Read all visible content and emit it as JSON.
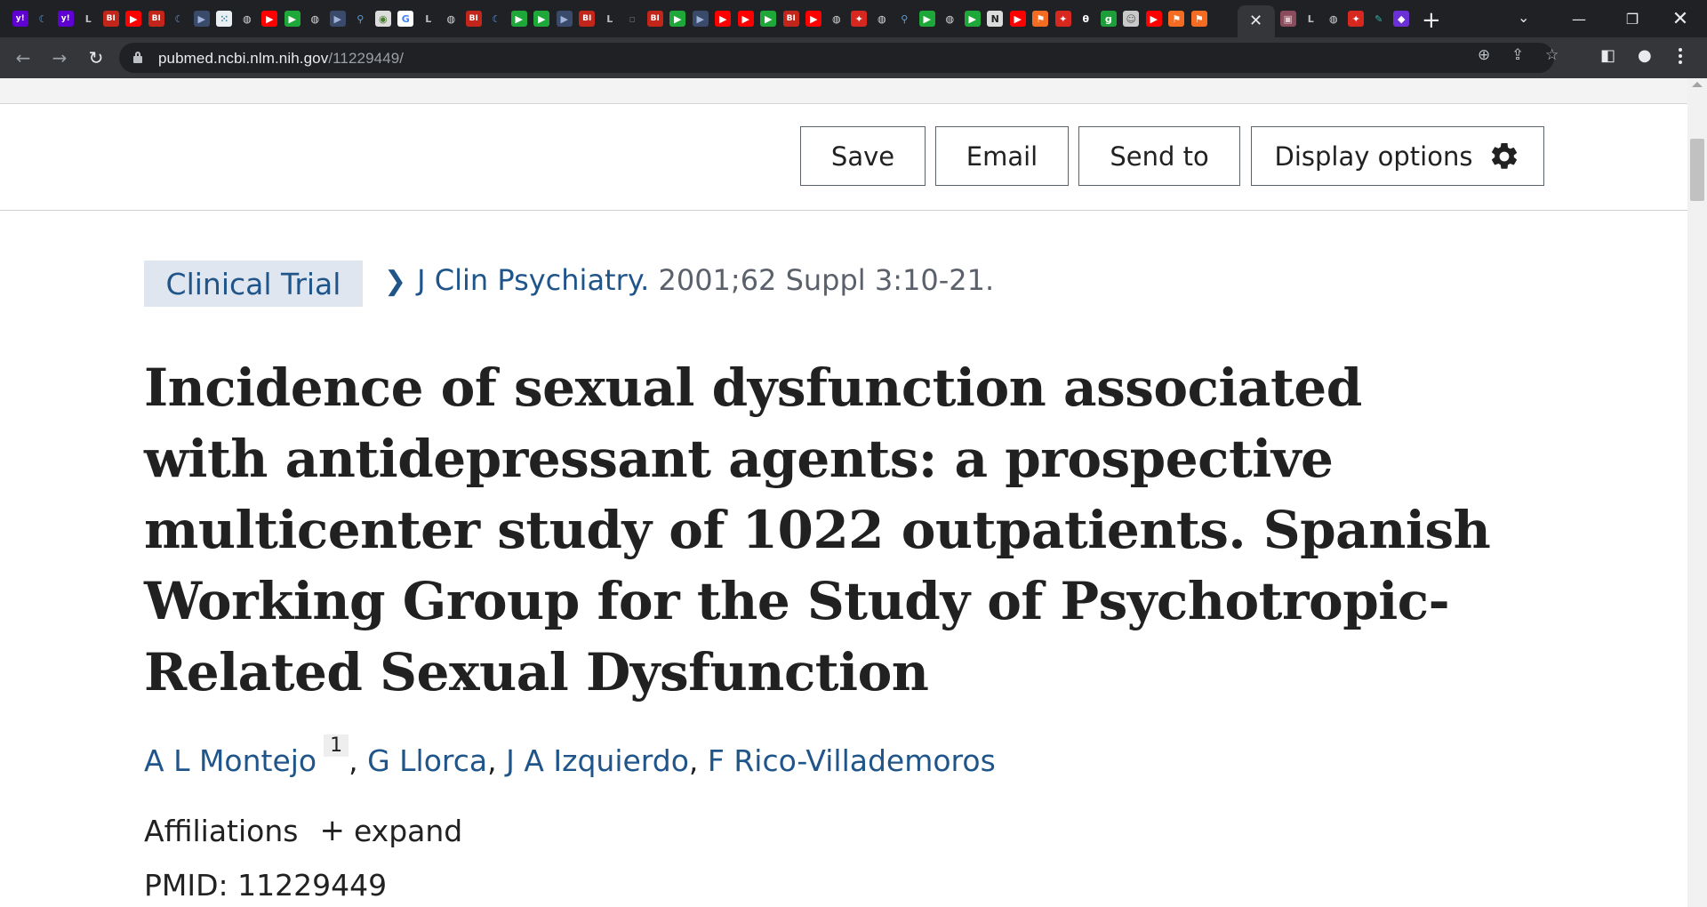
{
  "browser": {
    "url_host": "pubmed.ncbi.nlm.nih.gov",
    "url_path": "/11229449/",
    "tab_favicons": [
      {
        "icon": "yahoo-icon",
        "glyph": "y!",
        "bg": "#5f01d1",
        "fg": "#ffffff"
      },
      {
        "icon": "crescent-icon",
        "glyph": "☾",
        "bg": "#202124",
        "fg": "#5f9ee0"
      },
      {
        "icon": "yahoo-icon",
        "glyph": "y!",
        "bg": "#5f01d1",
        "fg": "#ffffff"
      },
      {
        "icon": "lit-icon",
        "glyph": "L",
        "bg": "#202124",
        "fg": "#bdbdbd"
      },
      {
        "icon": "bi-icon",
        "glyph": "BI",
        "bg": "#c2261b",
        "fg": "#ffffff"
      },
      {
        "icon": "youtube-icon",
        "glyph": "▶",
        "bg": "#ff0000",
        "fg": "#ffffff"
      },
      {
        "icon": "bi-icon",
        "glyph": "BI",
        "bg": "#c2261b",
        "fg": "#ffffff"
      },
      {
        "icon": "crescent-icon",
        "glyph": "☾",
        "bg": "#202124",
        "fg": "#5f9ee0"
      },
      {
        "icon": "play-flag-icon",
        "glyph": "▶",
        "bg": "#3a4a6b",
        "fg": "#9fb3d9"
      },
      {
        "icon": "dots-icon",
        "glyph": "⁙",
        "bg": "#e9eef2",
        "fg": "#3d7f9f"
      },
      {
        "icon": "globe-icon",
        "glyph": "◍",
        "bg": "#202124",
        "fg": "#dcdcdc"
      },
      {
        "icon": "youtube-icon",
        "glyph": "▶",
        "bg": "#ff0000",
        "fg": "#ffffff"
      },
      {
        "icon": "play-circle-icon",
        "glyph": "▶",
        "bg": "#1fa83a",
        "fg": "#ffffff"
      },
      {
        "icon": "globe-icon",
        "glyph": "◍",
        "bg": "#202124",
        "fg": "#dcdcdc"
      },
      {
        "icon": "play-flag-icon",
        "glyph": "▶",
        "bg": "#3a4a6b",
        "fg": "#9fb3d9"
      },
      {
        "icon": "search-icon",
        "glyph": "⚲",
        "bg": "#202124",
        "fg": "#5f9ee0"
      },
      {
        "icon": "tree-icon",
        "glyph": "◉",
        "bg": "#dcdcdc",
        "fg": "#4a7d2f"
      },
      {
        "icon": "google-icon",
        "glyph": "G",
        "bg": "#ffffff",
        "fg": "#4285f4"
      },
      {
        "icon": "lit-icon",
        "glyph": "L",
        "bg": "#202124",
        "fg": "#bdbdbd"
      },
      {
        "icon": "globe-icon",
        "glyph": "◍",
        "bg": "#202124",
        "fg": "#dcdcdc"
      },
      {
        "icon": "bi-icon",
        "glyph": "BI",
        "bg": "#c2261b",
        "fg": "#ffffff"
      },
      {
        "icon": "crescent-icon",
        "glyph": "☾",
        "bg": "#202124",
        "fg": "#5f9ee0"
      },
      {
        "icon": "play-circle-icon",
        "glyph": "▶",
        "bg": "#1fa83a",
        "fg": "#ffffff"
      },
      {
        "icon": "play-circle-icon",
        "glyph": "▶",
        "bg": "#1fa83a",
        "fg": "#ffffff"
      },
      {
        "icon": "play-flag-icon",
        "glyph": "▶",
        "bg": "#3a4a6b",
        "fg": "#9fb3d9"
      },
      {
        "icon": "bi-icon",
        "glyph": "BI",
        "bg": "#c2261b",
        "fg": "#ffffff"
      },
      {
        "icon": "lit-icon",
        "glyph": "L",
        "bg": "#202124",
        "fg": "#bdbdbd"
      },
      {
        "icon": "blank-icon",
        "glyph": "▫",
        "bg": "#202124",
        "fg": "#6b6b6b"
      },
      {
        "icon": "bi-icon",
        "glyph": "BI",
        "bg": "#c2261b",
        "fg": "#ffffff"
      },
      {
        "icon": "play-circle-icon",
        "glyph": "▶",
        "bg": "#1fa83a",
        "fg": "#ffffff"
      },
      {
        "icon": "play-flag-icon",
        "glyph": "▶",
        "bg": "#3a4a6b",
        "fg": "#9fb3d9"
      },
      {
        "icon": "youtube-icon",
        "glyph": "▶",
        "bg": "#ff0000",
        "fg": "#ffffff"
      },
      {
        "icon": "youtube-icon",
        "glyph": "▶",
        "bg": "#ff0000",
        "fg": "#ffffff"
      },
      {
        "icon": "play-circle-icon",
        "glyph": "▶",
        "bg": "#1fa83a",
        "fg": "#ffffff"
      },
      {
        "icon": "bi-icon",
        "glyph": "BI",
        "bg": "#c2261b",
        "fg": "#ffffff"
      },
      {
        "icon": "youtube-icon",
        "glyph": "▶",
        "bg": "#ff0000",
        "fg": "#ffffff"
      },
      {
        "icon": "globe-icon",
        "glyph": "◍",
        "bg": "#202124",
        "fg": "#dcdcdc"
      },
      {
        "icon": "red-pin-icon",
        "glyph": "✦",
        "bg": "#d6281f",
        "fg": "#ffffff"
      },
      {
        "icon": "globe-icon",
        "glyph": "◍",
        "bg": "#202124",
        "fg": "#dcdcdc"
      },
      {
        "icon": "search-icon",
        "glyph": "⚲",
        "bg": "#202124",
        "fg": "#5f9ee0"
      },
      {
        "icon": "play-circle-icon",
        "glyph": "▶",
        "bg": "#1fa83a",
        "fg": "#ffffff"
      },
      {
        "icon": "globe-icon",
        "glyph": "◍",
        "bg": "#202124",
        "fg": "#dcdcdc"
      },
      {
        "icon": "play-circle-icon",
        "glyph": "▶",
        "bg": "#1fa83a",
        "fg": "#ffffff"
      },
      {
        "icon": "news-icon",
        "glyph": "N",
        "bg": "#dcdcdc",
        "fg": "#202124"
      },
      {
        "icon": "youtube-icon",
        "glyph": "▶",
        "bg": "#ff0000",
        "fg": "#ffffff"
      },
      {
        "icon": "bookmark-orange-icon",
        "glyph": "⚑",
        "bg": "#f46b22",
        "fg": "#ffffff"
      },
      {
        "icon": "red-pin-icon",
        "glyph": "✦",
        "bg": "#d6281f",
        "fg": "#ffffff"
      },
      {
        "icon": "theta-icon",
        "glyph": "θ",
        "bg": "#202124",
        "fg": "#ffffff"
      },
      {
        "icon": "green-g-icon",
        "glyph": "g",
        "bg": "#1e9e3a",
        "fg": "#ffffff"
      },
      {
        "icon": "avatar-icon",
        "glyph": "☺",
        "bg": "#c9c9c9",
        "fg": "#5a5a5a"
      },
      {
        "icon": "youtube-icon",
        "glyph": "▶",
        "bg": "#ff0000",
        "fg": "#ffffff"
      },
      {
        "icon": "bookmark-orange-icon",
        "glyph": "⚑",
        "bg": "#f46b22",
        "fg": "#ffffff"
      },
      {
        "icon": "bookmark-orange-icon",
        "glyph": "⚑",
        "bg": "#f46b22",
        "fg": "#ffffff"
      }
    ],
    "tab_favicons_right": [
      {
        "icon": "photo-icon",
        "glyph": "▣",
        "bg": "#8a4b5c",
        "fg": "#e7c7cf"
      },
      {
        "icon": "lit-icon",
        "glyph": "L",
        "bg": "#202124",
        "fg": "#bdbdbd"
      },
      {
        "icon": "globe-icon",
        "glyph": "◍",
        "bg": "#202124",
        "fg": "#dcdcdc"
      },
      {
        "icon": "red-pin-icon",
        "glyph": "✦",
        "bg": "#d6281f",
        "fg": "#ffffff"
      },
      {
        "icon": "feather-icon",
        "glyph": "✎",
        "bg": "#202124",
        "fg": "#2bb5a8"
      },
      {
        "icon": "purple-icon",
        "glyph": "◆",
        "bg": "#6b2fd6",
        "fg": "#ffffff"
      }
    ]
  },
  "actions": {
    "save": "Save",
    "email": "Email",
    "send_to": "Send to",
    "display_options": "Display options"
  },
  "article": {
    "publication_type": "Clinical Trial",
    "journal": "J Clin Psychiatry.",
    "citation": "2001;62 Suppl 3:10-21.",
    "title": "Incidence of sexual dysfunction associated with antidepressant agents: a prospective multicenter study of 1022 outpatients. Spanish Working Group for the Study of Psychotropic-Related Sexual Dysfunction",
    "authors": {
      "first": "A L Montejo",
      "first_affiliation_ref": "1",
      "rest": [
        "G Llorca",
        "J A Izquierdo",
        "F Rico-Villademoros"
      ]
    },
    "affiliations_label": "Affiliations",
    "expand_label": "expand",
    "pmid_label": "PMID:",
    "pmid": "11229449"
  },
  "colors": {
    "link": "#20558a",
    "badge_bg": "#dfe6ef",
    "text": "#212121",
    "chrome_dark": "#202124",
    "chrome_toolbar": "#35363a"
  }
}
